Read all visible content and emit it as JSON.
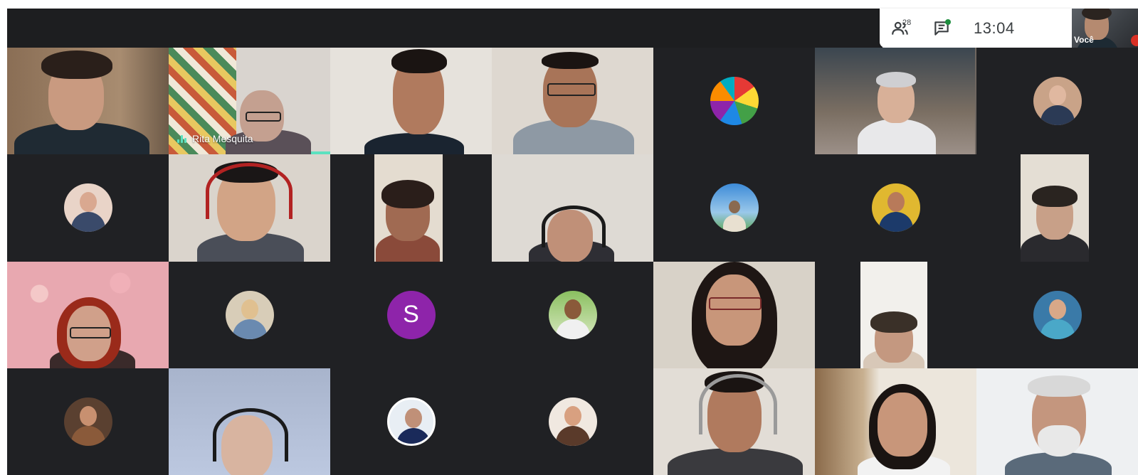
{
  "toolbar": {
    "participant_count": "28",
    "time": "13:04",
    "self_label": "Você"
  },
  "speaker": {
    "name": "Rita Mesquita"
  },
  "letter_avatar": {
    "letter": "S",
    "color": "#8e24aa"
  },
  "colors": {
    "grid_bg": "#202124",
    "active_outline": "#5ce1c0",
    "mic_off": "#d93025",
    "chat_dot": "#1e8e3e"
  }
}
